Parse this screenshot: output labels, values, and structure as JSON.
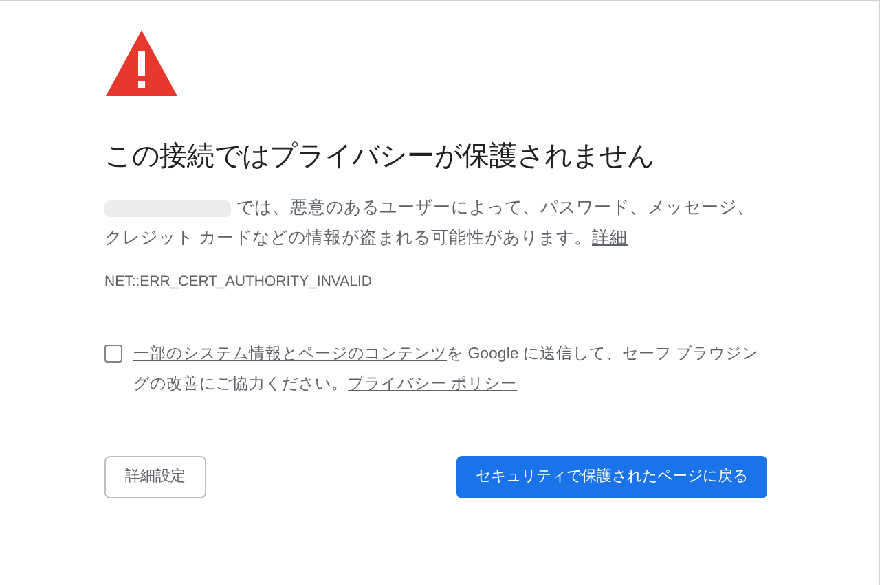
{
  "heading": "この接続ではプライバシーが保護されません",
  "description": {
    "text": "では、悪意のあるユーザーによって、パスワード、メッセージ、クレジット カードなどの情報が盗まれる可能性があります。",
    "link": "詳細"
  },
  "error_code": "NET::ERR_CERT_AUTHORITY_INVALID",
  "opt_in": {
    "checked": false,
    "parts": [
      {
        "kind": "link",
        "text": "一部のシステム情報とページのコンテンツ"
      },
      {
        "kind": "text",
        "text": "を Google に送信して、セーフ ブラウジングの改善にご協力ください。"
      },
      {
        "kind": "link",
        "text": "プライバシー ポリシー"
      }
    ]
  },
  "buttons": {
    "advanced": "詳細設定",
    "back": "セキュリティで保護されたページに戻る"
  }
}
